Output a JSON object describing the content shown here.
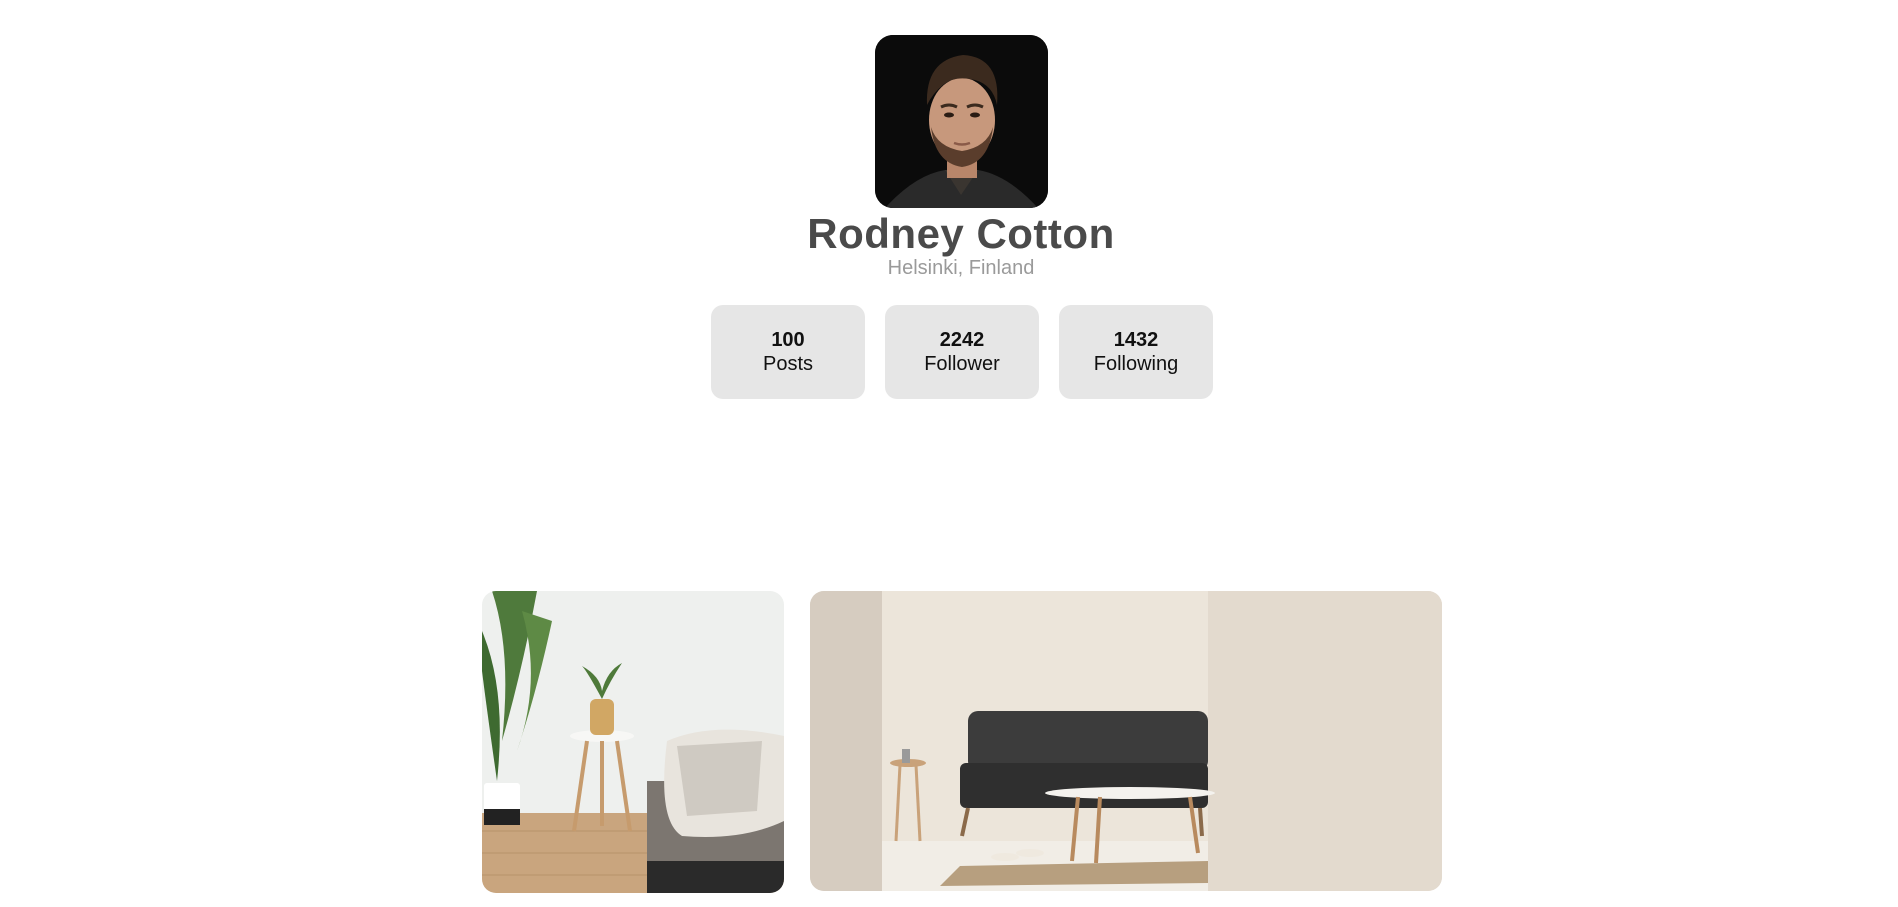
{
  "profile": {
    "name": "Rodney Cotton",
    "location": "Helsinki, Finland",
    "avatar_icon": "portrait-photo"
  },
  "stats": [
    {
      "value": "100",
      "label": "Posts"
    },
    {
      "value": "2242",
      "label": "Follower"
    },
    {
      "value": "1432",
      "label": "Following"
    }
  ],
  "gallery": {
    "photos": [
      {
        "subject": "bedroom-with-plant-photo"
      },
      {
        "subject": "living-room-sofa-photo"
      }
    ]
  },
  "colors": {
    "name": "#4a4a4a",
    "location": "#9a9a9a",
    "stat_bg": "#e6e6e6"
  }
}
